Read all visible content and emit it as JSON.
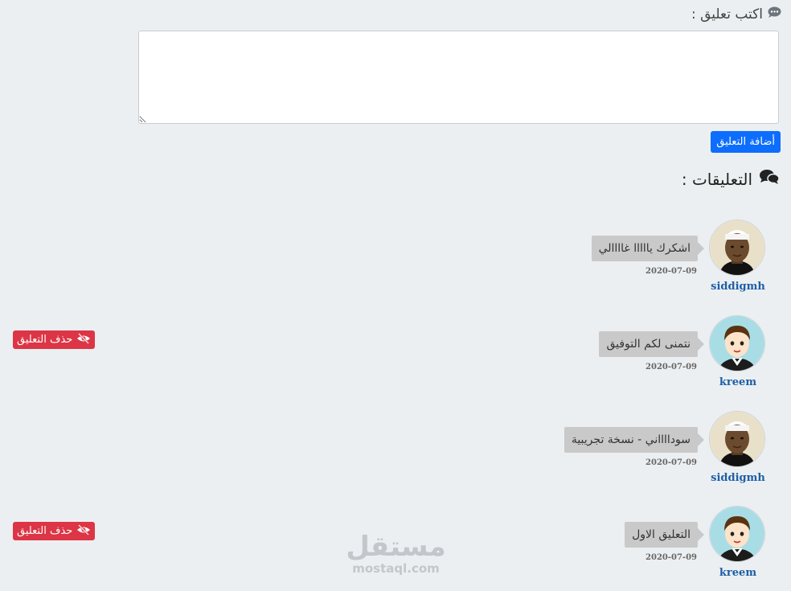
{
  "form": {
    "label": "اكتب تعليق :",
    "textarea_value": "",
    "submit_label": "أضافة التعليق"
  },
  "comments_heading": "التعليقات :",
  "comments": [
    {
      "user": "siddigmh",
      "text": "اشكرك يااااا غاااالي",
      "date": "2020-07-09",
      "avatar": "user-photo-icon"
    },
    {
      "user": "kreem",
      "text": "نتمنى لكم التوفيق",
      "date": "2020-07-09",
      "avatar": "cartoon-man-icon",
      "delete_label": "حذف التعليق"
    },
    {
      "user": "siddigmh",
      "text": "سودااااني - نسخة تجريبية",
      "date": "2020-07-09",
      "avatar": "user-photo-icon"
    },
    {
      "user": "kreem",
      "text": "التعليق الاول",
      "date": "2020-07-09",
      "avatar": "cartoon-man-icon",
      "delete_label": "حذف التعليق"
    }
  ],
  "watermark": {
    "arabic": "مستقل",
    "latin": "mostaql.com"
  },
  "colors": {
    "primary": "#0d6efd",
    "danger": "#dc3545",
    "link": "#1d5fa6",
    "background": "#eceff1",
    "bubble": "#c9c9c9"
  }
}
